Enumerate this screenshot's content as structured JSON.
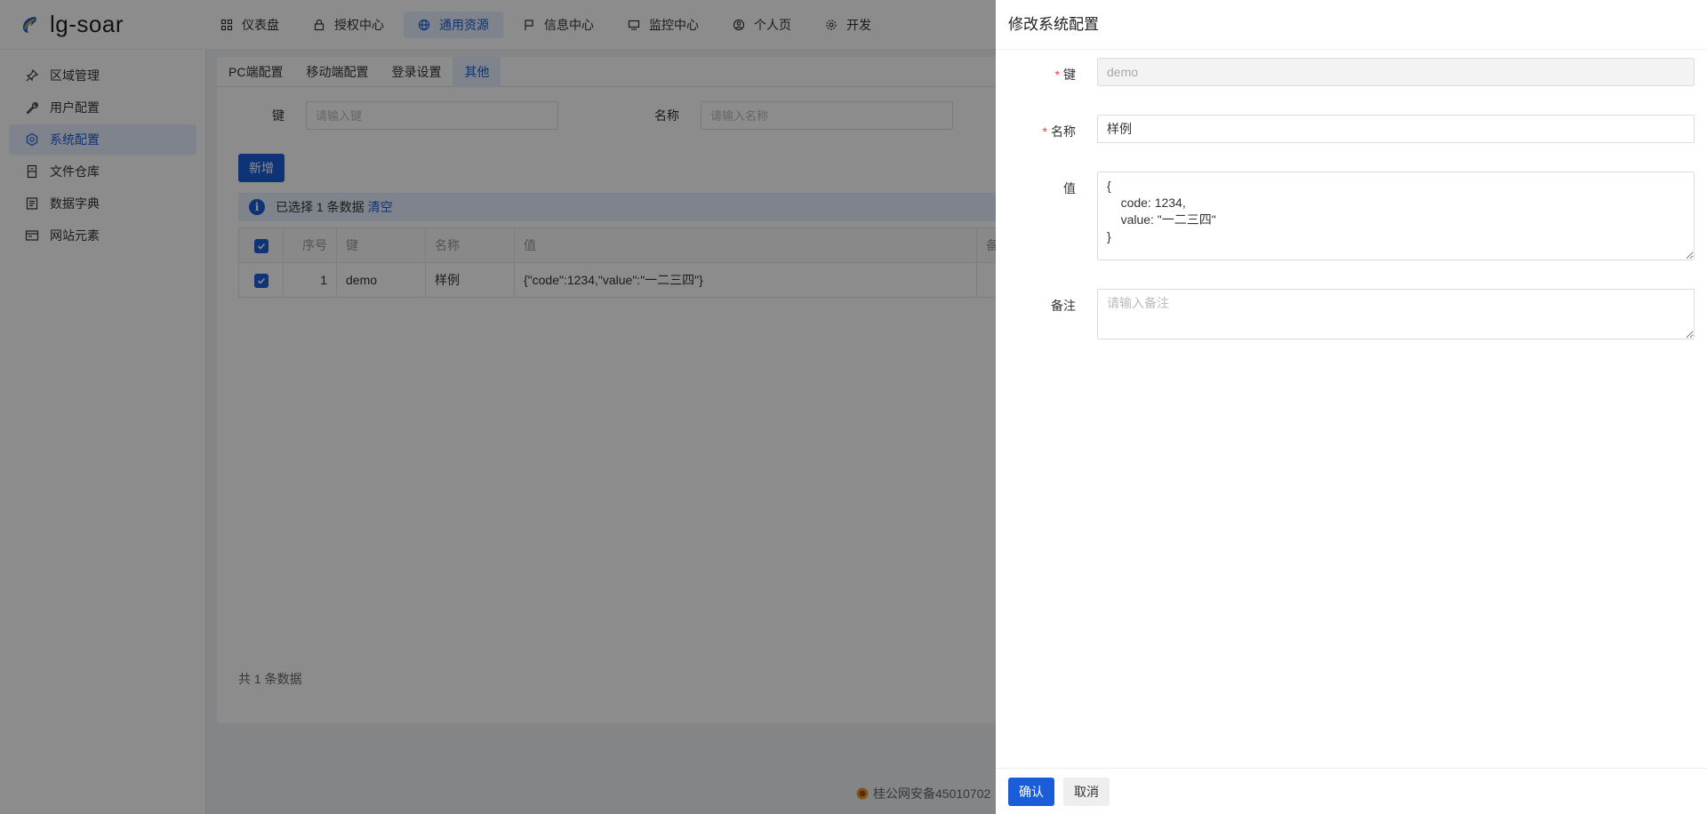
{
  "app": {
    "logo_text": "lg-soar"
  },
  "nav": {
    "items": [
      {
        "label": "仪表盘",
        "icon": "dashboard-icon"
      },
      {
        "label": "授权中心",
        "icon": "lock-icon"
      },
      {
        "label": "通用资源",
        "icon": "globe-icon",
        "active": true
      },
      {
        "label": "信息中心",
        "icon": "flag-icon"
      },
      {
        "label": "监控中心",
        "icon": "monitor-icon"
      },
      {
        "label": "个人页",
        "icon": "user-circle-icon"
      },
      {
        "label": "开发",
        "icon": "gear-icon"
      }
    ]
  },
  "sidebar": {
    "items": [
      {
        "label": "区域管理",
        "icon": "pin-icon"
      },
      {
        "label": "用户配置",
        "icon": "wrench-icon"
      },
      {
        "label": "系统配置",
        "icon": "settings-hex-icon",
        "active": true
      },
      {
        "label": "文件仓库",
        "icon": "archive-icon"
      },
      {
        "label": "数据字典",
        "icon": "book-icon"
      },
      {
        "label": "网站元素",
        "icon": "window-icon"
      }
    ]
  },
  "tabs": [
    {
      "label": "PC端配置"
    },
    {
      "label": "移动端配置"
    },
    {
      "label": "登录设置"
    },
    {
      "label": "其他",
      "active": true
    }
  ],
  "search": {
    "key_label": "键",
    "key_placeholder": "请输入键",
    "name_label": "名称",
    "name_placeholder": "请输入名称"
  },
  "toolbar": {
    "add_label": "新增"
  },
  "alert": {
    "text": "已选择 1 条数据",
    "clear_label": "清空"
  },
  "table": {
    "headers": {
      "index": "序号",
      "key": "键",
      "name": "名称",
      "value": "值",
      "remark": "备"
    },
    "rows": [
      {
        "index": "1",
        "key": "demo",
        "name": "样例",
        "value": "{\"code\":1234,\"value\":\"一二三四\"}"
      }
    ]
  },
  "pagination": {
    "total_text": "共 1 条数据"
  },
  "footer": {
    "icp_text": "桂公网安备45010702"
  },
  "drawer": {
    "title": "修改系统配置",
    "key_label": "键",
    "key_value": "demo",
    "name_label": "名称",
    "name_value": "样例",
    "value_label": "值",
    "value_text": "{\n\tcode: 1234,\n\tvalue: \"一二三四\"\n}",
    "remark_label": "备注",
    "remark_placeholder": "请输入备注",
    "confirm_label": "确认",
    "cancel_label": "取消"
  },
  "colors": {
    "primary": "#1a5dd8",
    "required": "#e8403a",
    "mask": "rgba(0,0,0,0.45)"
  }
}
